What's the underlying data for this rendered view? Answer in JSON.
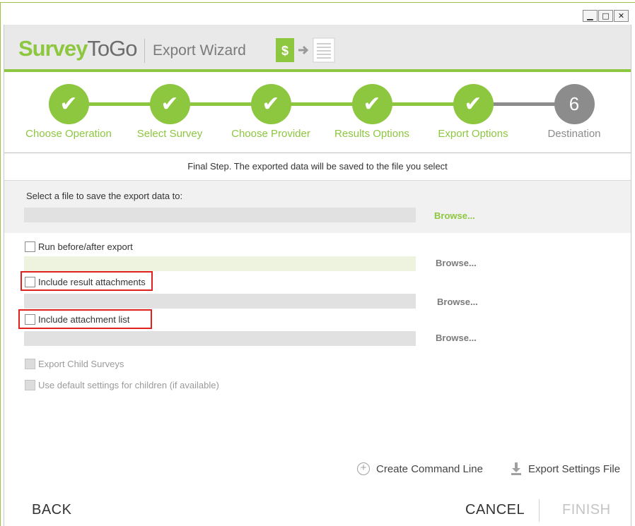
{
  "window": {
    "minimize": "▁",
    "maximize": "□",
    "close": "✕"
  },
  "header": {
    "logo_part1": "Survey",
    "logo_part2": "ToGo",
    "title": "Export Wizard",
    "icon": "export-transform-icon"
  },
  "steps": [
    {
      "label": "Choose Operation",
      "state": "done",
      "mark": "✔"
    },
    {
      "label": "Select Survey",
      "state": "done",
      "mark": "✔"
    },
    {
      "label": "Choose Provider",
      "state": "done",
      "mark": "✔"
    },
    {
      "label": "Results Options",
      "state": "done",
      "mark": "✔"
    },
    {
      "label": "Export Options",
      "state": "done",
      "mark": "✔"
    },
    {
      "label": "Destination",
      "state": "current",
      "mark": "6"
    }
  ],
  "note": "Final Step. The exported data will be saved to the file you select",
  "file": {
    "prompt": "Select a file to save the export data to:",
    "value": "",
    "browse": "Browse..."
  },
  "options": {
    "run_before_after": {
      "label": "Run before/after export",
      "value": "",
      "browse": "Browse..."
    },
    "include_result_attachments": {
      "label": "Include result attachments",
      "value": "",
      "browse": "Browse..."
    },
    "include_attachment_list": {
      "label": "Include attachment list",
      "value": "",
      "browse": "Browse..."
    },
    "export_child_surveys": {
      "label": "Export Child Surveys"
    },
    "use_default_settings": {
      "label": "Use default settings for children (if available)"
    }
  },
  "actions": {
    "create_command_line": "Create Command Line",
    "export_settings_file": "Export Settings File"
  },
  "footer": {
    "back": "BACK",
    "cancel": "CANCEL",
    "finish": "FINISH"
  },
  "colors": {
    "accent": "#8dc63f",
    "pending": "#8c8c8c",
    "highlight": "#e0201c"
  }
}
